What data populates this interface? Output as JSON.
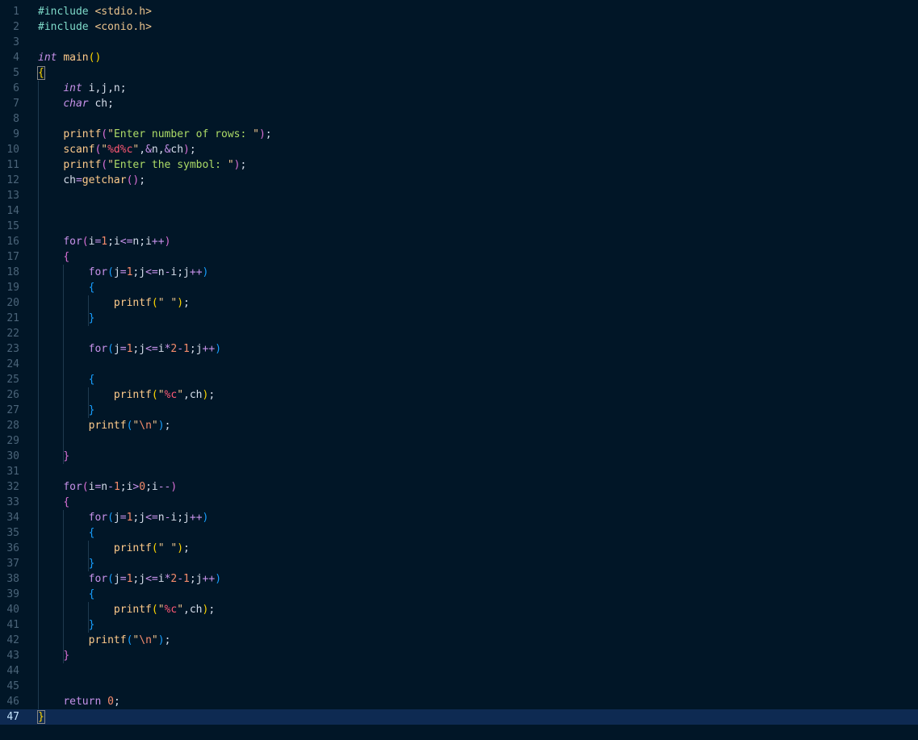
{
  "editor": {
    "language": "c",
    "current_line": 47,
    "lines": [
      {
        "n": "1",
        "t": [
          [
            "pp",
            "#include "
          ],
          [
            "str",
            "<stdio.h>"
          ]
        ]
      },
      {
        "n": "2",
        "t": [
          [
            "pp",
            "#include "
          ],
          [
            "str",
            "<conio.h>"
          ]
        ]
      },
      {
        "n": "3",
        "t": []
      },
      {
        "n": "4",
        "t": [
          [
            "kwi",
            "int"
          ],
          [
            "var",
            " "
          ],
          [
            "fnc",
            "main"
          ],
          [
            "br1",
            "()"
          ]
        ]
      },
      {
        "n": "5",
        "t": [
          [
            "br1",
            "{"
          ]
        ]
      },
      {
        "n": "6",
        "t": [
          [
            "var",
            "    "
          ],
          [
            "kwi",
            "int"
          ],
          [
            "var",
            " i,j,n;"
          ]
        ]
      },
      {
        "n": "7",
        "t": [
          [
            "var",
            "    "
          ],
          [
            "kwi",
            "char"
          ],
          [
            "var",
            " ch;"
          ]
        ]
      },
      {
        "n": "8",
        "t": []
      },
      {
        "n": "9",
        "t": [
          [
            "var",
            "    "
          ],
          [
            "fnc",
            "printf"
          ],
          [
            "br2",
            "("
          ],
          [
            "str",
            "\""
          ],
          [
            "sg",
            "Enter number of rows: "
          ],
          [
            "str",
            "\""
          ],
          [
            "br2",
            ")"
          ],
          [
            "var",
            ";"
          ]
        ]
      },
      {
        "n": "10",
        "t": [
          [
            "var",
            "    "
          ],
          [
            "fnc",
            "scanf"
          ],
          [
            "br2",
            "("
          ],
          [
            "str",
            "\""
          ],
          [
            "fmt",
            "%d%c"
          ],
          [
            "str",
            "\""
          ],
          [
            "var",
            ","
          ],
          [
            "op",
            "&"
          ],
          [
            "var",
            "n,"
          ],
          [
            "op",
            "&"
          ],
          [
            "var",
            "ch"
          ],
          [
            "br2",
            ")"
          ],
          [
            "var",
            ";"
          ]
        ]
      },
      {
        "n": "11",
        "t": [
          [
            "var",
            "    "
          ],
          [
            "fnc",
            "printf"
          ],
          [
            "br2",
            "("
          ],
          [
            "str",
            "\""
          ],
          [
            "sg",
            "Enter the symbol: "
          ],
          [
            "str",
            "\""
          ],
          [
            "br2",
            ")"
          ],
          [
            "var",
            ";"
          ]
        ]
      },
      {
        "n": "12",
        "t": [
          [
            "var",
            "    "
          ],
          [
            "var",
            "ch"
          ],
          [
            "op",
            "="
          ],
          [
            "fnc",
            "getchar"
          ],
          [
            "br2",
            "()"
          ],
          [
            "var",
            ";"
          ]
        ]
      },
      {
        "n": "13",
        "t": []
      },
      {
        "n": "14",
        "t": []
      },
      {
        "n": "15",
        "t": []
      },
      {
        "n": "16",
        "t": [
          [
            "var",
            "    "
          ],
          [
            "kw",
            "for"
          ],
          [
            "br2",
            "("
          ],
          [
            "var",
            "i"
          ],
          [
            "op",
            "="
          ],
          [
            "num",
            "1"
          ],
          [
            "var",
            ";i"
          ],
          [
            "op",
            "<="
          ],
          [
            "var",
            "n;i"
          ],
          [
            "op",
            "++"
          ],
          [
            "br2",
            ")"
          ]
        ]
      },
      {
        "n": "17",
        "t": [
          [
            "var",
            "    "
          ],
          [
            "br2",
            "{"
          ]
        ]
      },
      {
        "n": "18",
        "t": [
          [
            "var",
            "        "
          ],
          [
            "kw",
            "for"
          ],
          [
            "br3",
            "("
          ],
          [
            "var",
            "j"
          ],
          [
            "op",
            "="
          ],
          [
            "num",
            "1"
          ],
          [
            "var",
            ";j"
          ],
          [
            "op",
            "<="
          ],
          [
            "var",
            "n"
          ],
          [
            "op",
            "-"
          ],
          [
            "var",
            "i;j"
          ],
          [
            "op",
            "++"
          ],
          [
            "br3",
            ")"
          ]
        ]
      },
      {
        "n": "19",
        "t": [
          [
            "var",
            "        "
          ],
          [
            "br3",
            "{"
          ]
        ]
      },
      {
        "n": "20",
        "t": [
          [
            "var",
            "            "
          ],
          [
            "fnc",
            "printf"
          ],
          [
            "br1",
            "("
          ],
          [
            "str",
            "\" \""
          ],
          [
            "br1",
            ")"
          ],
          [
            "var",
            ";"
          ]
        ]
      },
      {
        "n": "21",
        "t": [
          [
            "var",
            "        "
          ],
          [
            "br3",
            "}"
          ]
        ]
      },
      {
        "n": "22",
        "t": []
      },
      {
        "n": "23",
        "t": [
          [
            "var",
            "        "
          ],
          [
            "kw",
            "for"
          ],
          [
            "br3",
            "("
          ],
          [
            "var",
            "j"
          ],
          [
            "op",
            "="
          ],
          [
            "num",
            "1"
          ],
          [
            "var",
            ";j"
          ],
          [
            "op",
            "<="
          ],
          [
            "var",
            "i"
          ],
          [
            "op",
            "*"
          ],
          [
            "num",
            "2"
          ],
          [
            "op",
            "-"
          ],
          [
            "num",
            "1"
          ],
          [
            "var",
            ";j"
          ],
          [
            "op",
            "++"
          ],
          [
            "br3",
            ")"
          ]
        ]
      },
      {
        "n": "24",
        "t": []
      },
      {
        "n": "25",
        "t": [
          [
            "var",
            "        "
          ],
          [
            "br3",
            "{"
          ]
        ]
      },
      {
        "n": "26",
        "t": [
          [
            "var",
            "            "
          ],
          [
            "fnc",
            "printf"
          ],
          [
            "br1",
            "("
          ],
          [
            "str",
            "\""
          ],
          [
            "fmt",
            "%c"
          ],
          [
            "str",
            "\""
          ],
          [
            "var",
            ",ch"
          ],
          [
            "br1",
            ")"
          ],
          [
            "var",
            ";"
          ]
        ]
      },
      {
        "n": "27",
        "t": [
          [
            "var",
            "        "
          ],
          [
            "br3",
            "}"
          ]
        ]
      },
      {
        "n": "28",
        "t": [
          [
            "var",
            "        "
          ],
          [
            "fnc",
            "printf"
          ],
          [
            "br3",
            "("
          ],
          [
            "str",
            "\""
          ],
          [
            "esc",
            "\\n"
          ],
          [
            "str",
            "\""
          ],
          [
            "br3",
            ")"
          ],
          [
            "var",
            ";"
          ]
        ]
      },
      {
        "n": "29",
        "t": []
      },
      {
        "n": "30",
        "t": [
          [
            "var",
            "    "
          ],
          [
            "br2",
            "}"
          ]
        ]
      },
      {
        "n": "31",
        "t": []
      },
      {
        "n": "32",
        "t": [
          [
            "var",
            "    "
          ],
          [
            "kw",
            "for"
          ],
          [
            "br2",
            "("
          ],
          [
            "var",
            "i"
          ],
          [
            "op",
            "="
          ],
          [
            "var",
            "n"
          ],
          [
            "op",
            "-"
          ],
          [
            "num",
            "1"
          ],
          [
            "var",
            ";i"
          ],
          [
            "op",
            ">"
          ],
          [
            "num",
            "0"
          ],
          [
            "var",
            ";i"
          ],
          [
            "op",
            "--"
          ],
          [
            "br2",
            ")"
          ]
        ]
      },
      {
        "n": "33",
        "t": [
          [
            "var",
            "    "
          ],
          [
            "br2",
            "{"
          ]
        ]
      },
      {
        "n": "34",
        "t": [
          [
            "var",
            "        "
          ],
          [
            "kw",
            "for"
          ],
          [
            "br3",
            "("
          ],
          [
            "var",
            "j"
          ],
          [
            "op",
            "="
          ],
          [
            "num",
            "1"
          ],
          [
            "var",
            ";j"
          ],
          [
            "op",
            "<="
          ],
          [
            "var",
            "n"
          ],
          [
            "op",
            "-"
          ],
          [
            "var",
            "i;j"
          ],
          [
            "op",
            "++"
          ],
          [
            "br3",
            ")"
          ]
        ]
      },
      {
        "n": "35",
        "t": [
          [
            "var",
            "        "
          ],
          [
            "br3",
            "{"
          ]
        ]
      },
      {
        "n": "36",
        "t": [
          [
            "var",
            "            "
          ],
          [
            "fnc",
            "printf"
          ],
          [
            "br1",
            "("
          ],
          [
            "str",
            "\" \""
          ],
          [
            "br1",
            ")"
          ],
          [
            "var",
            ";"
          ]
        ]
      },
      {
        "n": "37",
        "t": [
          [
            "var",
            "        "
          ],
          [
            "br3",
            "}"
          ]
        ]
      },
      {
        "n": "38",
        "t": [
          [
            "var",
            "        "
          ],
          [
            "kw",
            "for"
          ],
          [
            "br3",
            "("
          ],
          [
            "var",
            "j"
          ],
          [
            "op",
            "="
          ],
          [
            "num",
            "1"
          ],
          [
            "var",
            ";j"
          ],
          [
            "op",
            "<="
          ],
          [
            "var",
            "i"
          ],
          [
            "op",
            "*"
          ],
          [
            "num",
            "2"
          ],
          [
            "op",
            "-"
          ],
          [
            "num",
            "1"
          ],
          [
            "var",
            ";j"
          ],
          [
            "op",
            "++"
          ],
          [
            "br3",
            ")"
          ]
        ]
      },
      {
        "n": "39",
        "t": [
          [
            "var",
            "        "
          ],
          [
            "br3",
            "{"
          ]
        ]
      },
      {
        "n": "40",
        "t": [
          [
            "var",
            "            "
          ],
          [
            "fnc",
            "printf"
          ],
          [
            "br1",
            "("
          ],
          [
            "str",
            "\""
          ],
          [
            "fmt",
            "%c"
          ],
          [
            "str",
            "\""
          ],
          [
            "var",
            ",ch"
          ],
          [
            "br1",
            ")"
          ],
          [
            "var",
            ";"
          ]
        ]
      },
      {
        "n": "41",
        "t": [
          [
            "var",
            "        "
          ],
          [
            "br3",
            "}"
          ]
        ]
      },
      {
        "n": "42",
        "t": [
          [
            "var",
            "        "
          ],
          [
            "fnc",
            "printf"
          ],
          [
            "br3",
            "("
          ],
          [
            "str",
            "\""
          ],
          [
            "esc",
            "\\n"
          ],
          [
            "str",
            "\""
          ],
          [
            "br3",
            ")"
          ],
          [
            "var",
            ";"
          ]
        ]
      },
      {
        "n": "43",
        "t": [
          [
            "var",
            "    "
          ],
          [
            "br2",
            "}"
          ]
        ]
      },
      {
        "n": "44",
        "t": []
      },
      {
        "n": "45",
        "t": []
      },
      {
        "n": "46",
        "t": [
          [
            "var",
            "    "
          ],
          [
            "kw",
            "return"
          ],
          [
            "var",
            " "
          ],
          [
            "num",
            "0"
          ],
          [
            "var",
            ";"
          ]
        ]
      },
      {
        "n": "47",
        "t": [
          [
            "br1",
            "}"
          ]
        ]
      }
    ]
  },
  "colors": {
    "background": "#011627",
    "current_line": "#0e2a52",
    "line_number": "#4b6479",
    "text": "#d6deeb"
  }
}
